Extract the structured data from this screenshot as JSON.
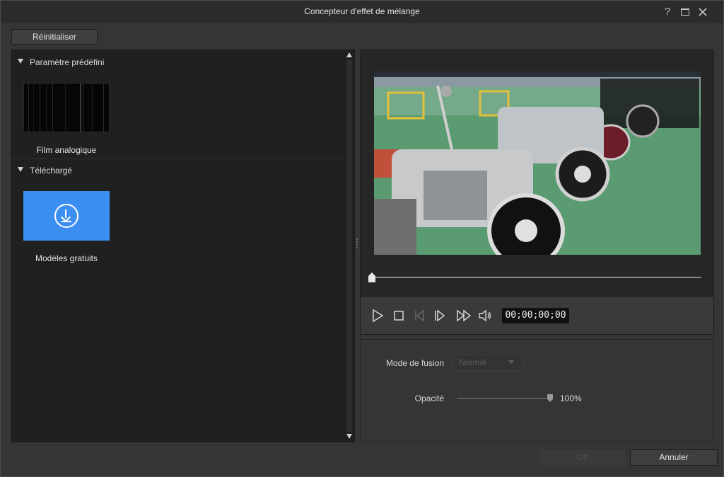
{
  "window": {
    "title": "Concepteur d'effet de mélange",
    "help_label": "?"
  },
  "toolbar": {
    "reset_label": "Réinitialiser"
  },
  "presets": {
    "sections": [
      {
        "label": "Paramètre prédéfini",
        "items": [
          {
            "label": "Film analogique",
            "icon": "film-thumbnail"
          }
        ]
      },
      {
        "label": "Téléchargé",
        "items": [
          {
            "label": "Modèles gratuits",
            "icon": "download-icon"
          }
        ]
      }
    ]
  },
  "player": {
    "timecode": "00;00;00;00",
    "progress": 0,
    "controls": [
      "play-icon",
      "stop-icon",
      "previous-frame-icon",
      "next-frame-icon",
      "fast-forward-icon",
      "volume-icon"
    ]
  },
  "settings": {
    "blend_mode_label": "Mode de fusion",
    "blend_mode_value": "Normal",
    "opacity_label": "Opacité",
    "opacity_value": "100%",
    "opacity_fraction": 1.0
  },
  "footer": {
    "ok_label": "OK",
    "cancel_label": "Annuler"
  },
  "colors": {
    "accent_blue": "#3c8ef0",
    "background": "#353535",
    "panel_dark": "#202020"
  }
}
